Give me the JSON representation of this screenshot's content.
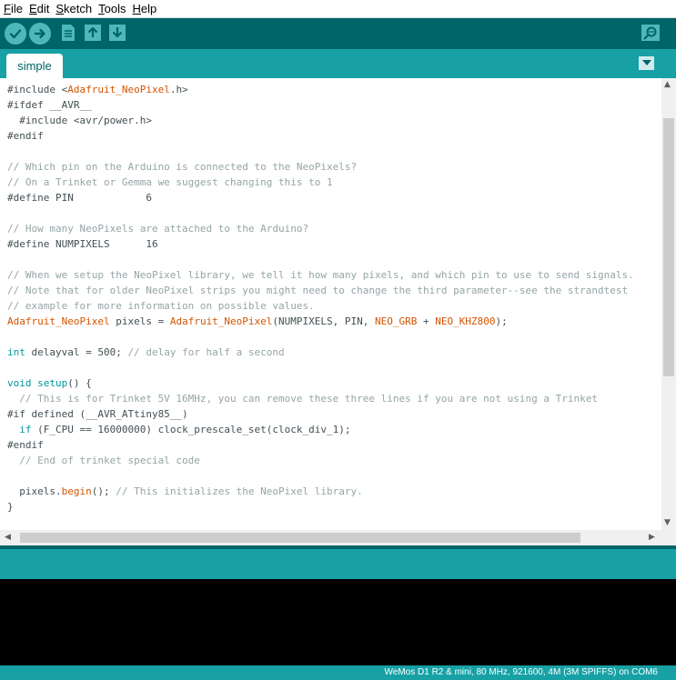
{
  "menu": {
    "items": [
      {
        "acc": "F",
        "rest": "ile"
      },
      {
        "acc": "E",
        "rest": "dit"
      },
      {
        "acc": "S",
        "rest": "ketch"
      },
      {
        "acc": "T",
        "rest": "ools"
      },
      {
        "acc": "H",
        "rest": "elp"
      }
    ]
  },
  "toolbar": {
    "buttons": [
      "verify-icon",
      "upload-icon",
      "new-icon",
      "open-icon",
      "save-icon",
      "serial-monitor-icon"
    ]
  },
  "tabs": [
    {
      "label": "simple"
    }
  ],
  "editor": {
    "lines": [
      [
        [
          "p",
          "#include <"
        ],
        [
          "lib",
          "Adafruit_NeoPixel"
        ],
        [
          "p",
          ".h>"
        ]
      ],
      [
        [
          "p",
          "#ifdef __AVR__"
        ]
      ],
      [
        [
          "p",
          "  #include <avr/power.h>"
        ]
      ],
      [
        [
          "p",
          "#endif"
        ]
      ],
      [],
      [
        [
          "cmt",
          "// Which pin on the Arduino is connected to the NeoPixels?"
        ]
      ],
      [
        [
          "cmt",
          "// On a Trinket or Gemma we suggest changing this to 1"
        ]
      ],
      [
        [
          "p",
          "#define PIN            6"
        ]
      ],
      [],
      [
        [
          "cmt",
          "// How many NeoPixels are attached to the Arduino?"
        ]
      ],
      [
        [
          "p",
          "#define NUMPIXELS      16"
        ]
      ],
      [],
      [
        [
          "cmt",
          "// When we setup the NeoPixel library, we tell it how many pixels, and which pin to use to send signals."
        ]
      ],
      [
        [
          "cmt",
          "// Note that for older NeoPixel strips you might need to change the third parameter--see the strandtest"
        ]
      ],
      [
        [
          "cmt",
          "// example for more information on possible values."
        ]
      ],
      [
        [
          "lib",
          "Adafruit_NeoPixel"
        ],
        [
          "p",
          " pixels = "
        ],
        [
          "lib",
          "Adafruit_NeoPixel"
        ],
        [
          "p",
          "(NUMPIXELS, PIN, "
        ],
        [
          "lib",
          "NEO_GRB"
        ],
        [
          "p",
          " + "
        ],
        [
          "lib",
          "NEO_KHZ800"
        ],
        [
          "p",
          ");"
        ]
      ],
      [],
      [
        [
          "kw",
          "int"
        ],
        [
          "p",
          " delayval = 500; "
        ],
        [
          "cmt",
          "// delay for half a second"
        ]
      ],
      [],
      [
        [
          "kw",
          "void"
        ],
        [
          "p",
          " "
        ],
        [
          "kw",
          "setup"
        ],
        [
          "p",
          "() {"
        ]
      ],
      [
        [
          "cmt",
          "  // This is for Trinket 5V 16MHz, you can remove these three lines if you are not using a Trinket"
        ]
      ],
      [
        [
          "p",
          "#if defined (__AVR_ATtiny85__)"
        ]
      ],
      [
        [
          "p",
          "  "
        ],
        [
          "kw",
          "if"
        ],
        [
          "p",
          " (F_CPU == 16000000) clock_prescale_set(clock_div_1);"
        ]
      ],
      [
        [
          "p",
          "#endif"
        ]
      ],
      [
        [
          "cmt",
          "  // End of trinket special code"
        ]
      ],
      [],
      [
        [
          "p",
          "  pixels."
        ],
        [
          "lib",
          "begin"
        ],
        [
          "p",
          "(); "
        ],
        [
          "cmt",
          "// This initializes the NeoPixel library."
        ]
      ],
      [
        [
          "p",
          "}"
        ]
      ]
    ]
  },
  "status": {
    "board": "WeMos D1 R2 & mini, 80 MHz, 921600, 4M (3M SPIFFS) on COM6"
  }
}
